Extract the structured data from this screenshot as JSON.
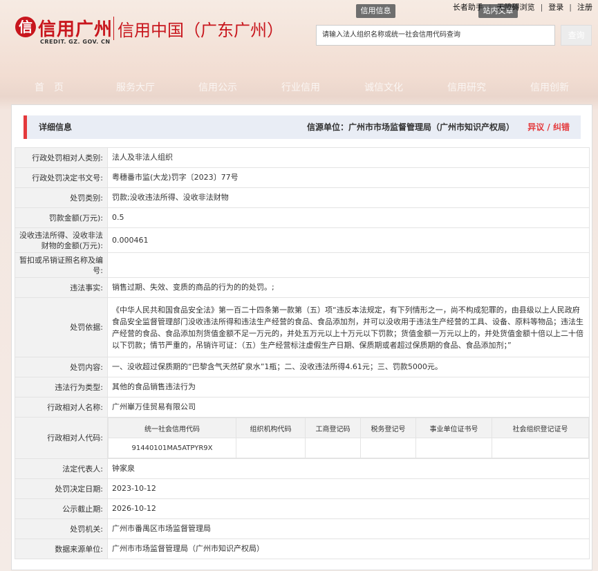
{
  "header": {
    "logo_mark": "信",
    "logo_title": "信用广州",
    "logo_sub": "信用中国（广东广州）",
    "logo_url": "CREDIT. GZ. GOV. CN",
    "tab_credit": "信用信息",
    "tab_site": "站内文章",
    "top_links": [
      "长者助手",
      "无障碍浏览",
      "登录",
      "注册"
    ],
    "search_placeholder": "请输入法人组织名称或统一社会信用代码查询",
    "search_button": "查询"
  },
  "nav": [
    "首　页",
    "服务大厅",
    "信用公示",
    "行业信用",
    "诚信文化",
    "信用研究",
    "信用创新"
  ],
  "panel": {
    "title": "详细信息",
    "source": "信源单位：广州市市场监督管理局（广州市知识产权局）",
    "objection": "异议 / 纠错"
  },
  "rows": {
    "r1": {
      "label": "行政处罚相对人类别:",
      "value": "法人及非法人组织"
    },
    "r2": {
      "label": "行政处罚决定书文号:",
      "value": "粤穗番市监(大龙)罚字〔2023〕77号"
    },
    "r3": {
      "label": "处罚类别:",
      "value": "罚款;没收违法所得、没收非法财物"
    },
    "r4": {
      "label": "罚款金额(万元):",
      "value": "0.5"
    },
    "r5": {
      "label": "没收违法所得、没收非法财物的金额(万元):",
      "value": "0.000461"
    },
    "r6": {
      "label": "暂扣或吊销证照名称及编号:",
      "value": ""
    },
    "r7": {
      "label": "违法事实:",
      "value": "销售过期、失效、变质的商品的行为的的处罚。;"
    },
    "r8": {
      "label": "处罚依据:",
      "value": "《中华人民共和国食品安全法》第一百二十四条第一款第（五）项“违反本法规定，有下列情形之一，尚不构成犯罪的，由县级以上人民政府食品安全监督管理部门没收违法所得和违法生产经营的食品、食品添加剂，并可以没收用于违法生产经营的工具、设备、原料等物品；违法生产经营的食品、食品添加剂货值金额不足一万元的，并处五万元以上十万元以下罚款；货值金额一万元以上的，并处货值金额十倍以上二十倍以下罚款；情节严重的，吊销许可证：（五）生产经营标注虚假生产日期、保质期或者超过保质期的食品、食品添加剂；”"
    },
    "r9": {
      "label": "处罚内容:",
      "value": "一、没收超过保质期的“巴黎含气天然矿泉水”1瓶；二、没收违法所得4.61元；三、罚款5000元。"
    },
    "r10": {
      "label": "违法行为类型:",
      "value": "其他的食品销售违法行为"
    },
    "r11": {
      "label": "行政相对人名称:",
      "value": "广州崋万佳贸易有限公司"
    },
    "r12": {
      "label": "行政相对人代码:",
      "headers": [
        "统一社会信用代码",
        "组织机构代码",
        "工商登记码",
        "税务登记号",
        "事业单位证书号",
        "社会组织登记证号"
      ],
      "values": [
        "91440101MA5ATPYR9X",
        "",
        "",
        "",
        "",
        ""
      ]
    },
    "r13": {
      "label": "法定代表人:",
      "value": "钟家泉"
    },
    "r14": {
      "label": "处罚决定日期:",
      "value": "2023-10-12"
    },
    "r15": {
      "label": "公示截止期:",
      "value": "2026-10-12"
    },
    "r16": {
      "label": "处罚机关:",
      "value": "广州市番禺区市场监督管理局"
    },
    "r17": {
      "label": "数据来源单位:",
      "value": "广州市市场监督管理局（广州市知识产权局）"
    }
  },
  "colors": {
    "brand_red": "#c8161d",
    "accent_red": "#e4393c",
    "label_bg": "#f2f2f2",
    "head_bg": "#e9edf5"
  }
}
